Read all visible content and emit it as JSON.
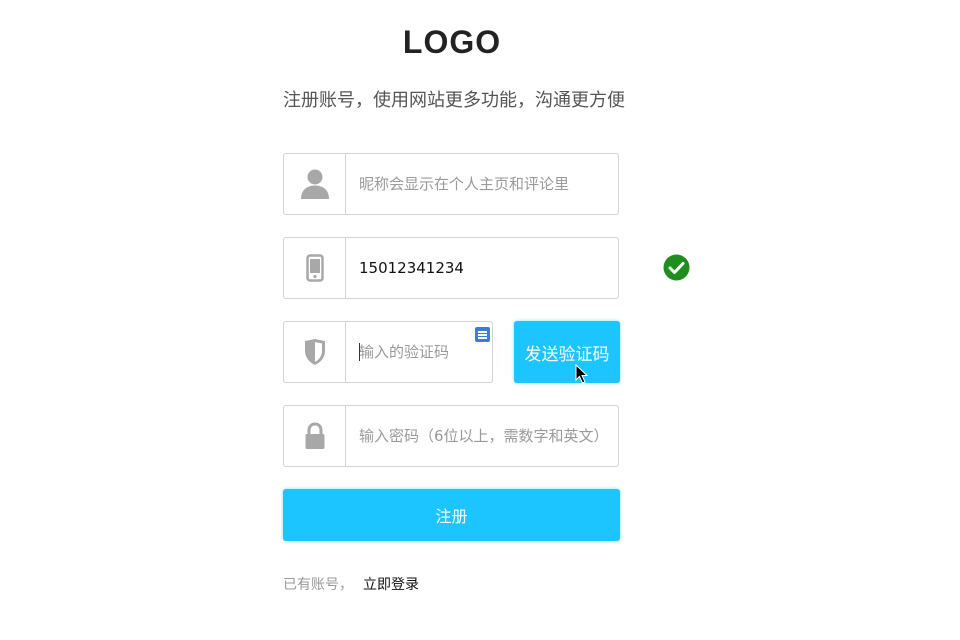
{
  "logo": "LOGO",
  "subtitle": "注册账号，使用网站更多功能，沟通更方便",
  "form": {
    "nickname": {
      "value": "",
      "placeholder": "昵称会显示在个人主页和评论里",
      "icon": "user-icon"
    },
    "phone": {
      "value": "15012341234",
      "placeholder": "",
      "icon": "phone-icon",
      "status": "valid"
    },
    "code": {
      "value": "",
      "placeholder": "输入的验证码",
      "icon": "shield-icon"
    },
    "password": {
      "value": "",
      "placeholder": "输入密码（6位以上，需数字和英文）",
      "icon": "lock-icon"
    },
    "send_code_label": "发送验证码",
    "register_label": "注册"
  },
  "footer": {
    "prompt": "已有账号，",
    "login_link": "立即登录"
  },
  "colors": {
    "accent": "#1cc5ff",
    "success": "#1e8e1e",
    "icon_gray": "#a8a8a8",
    "border": "#d4d4d4"
  }
}
